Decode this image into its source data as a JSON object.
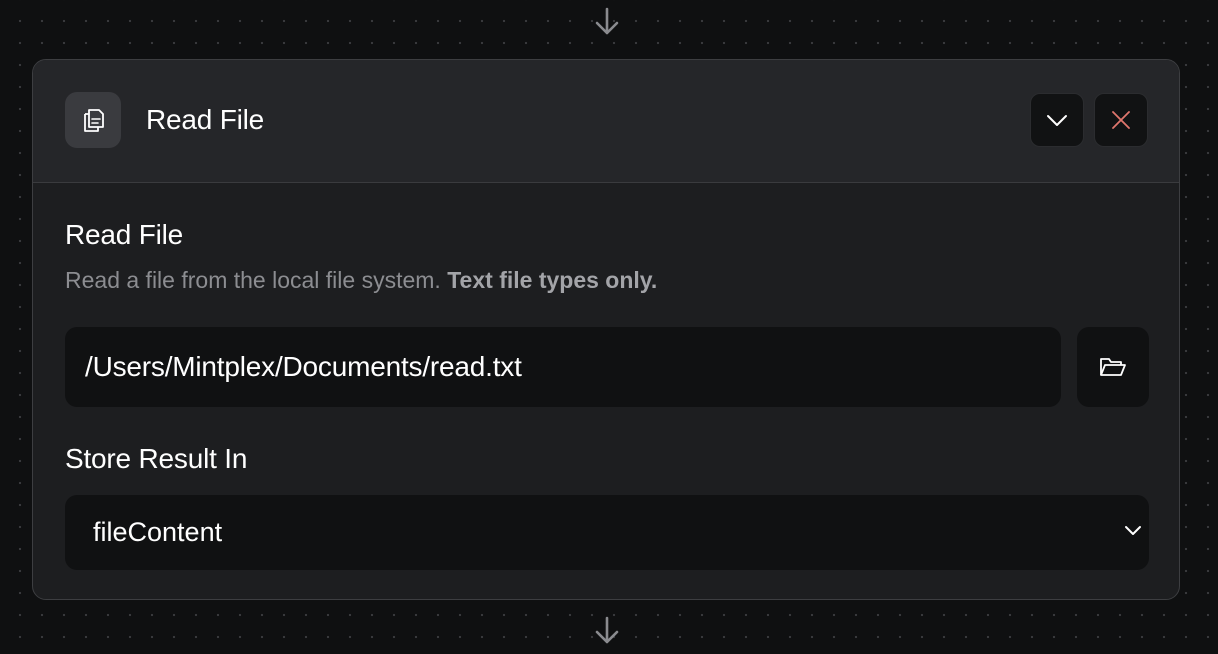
{
  "flow": {
    "top_connector_icon": "arrow-down-icon",
    "bottom_connector_icon": "arrow-down-icon"
  },
  "block": {
    "icon": "file-copy-icon",
    "header_title": "Read File",
    "collapse_icon": "chevron-down-icon",
    "delete_icon": "close-icon",
    "section_title": "Read File",
    "description": "Read a file from the local file system.",
    "description_emphasis": "Text file types only.",
    "file_path": {
      "value": "/Users/Mintplex/Documents/read.txt",
      "browse_icon": "folder-open-icon"
    },
    "store_result": {
      "label": "Store Result In",
      "selected": "fileContent",
      "chevron_icon": "chevron-down-icon"
    }
  },
  "colors": {
    "background": "#0f1011",
    "card": "#1d1e20",
    "card_header": "#252629",
    "input": "#101112",
    "delete_accent": "#e0766d"
  }
}
